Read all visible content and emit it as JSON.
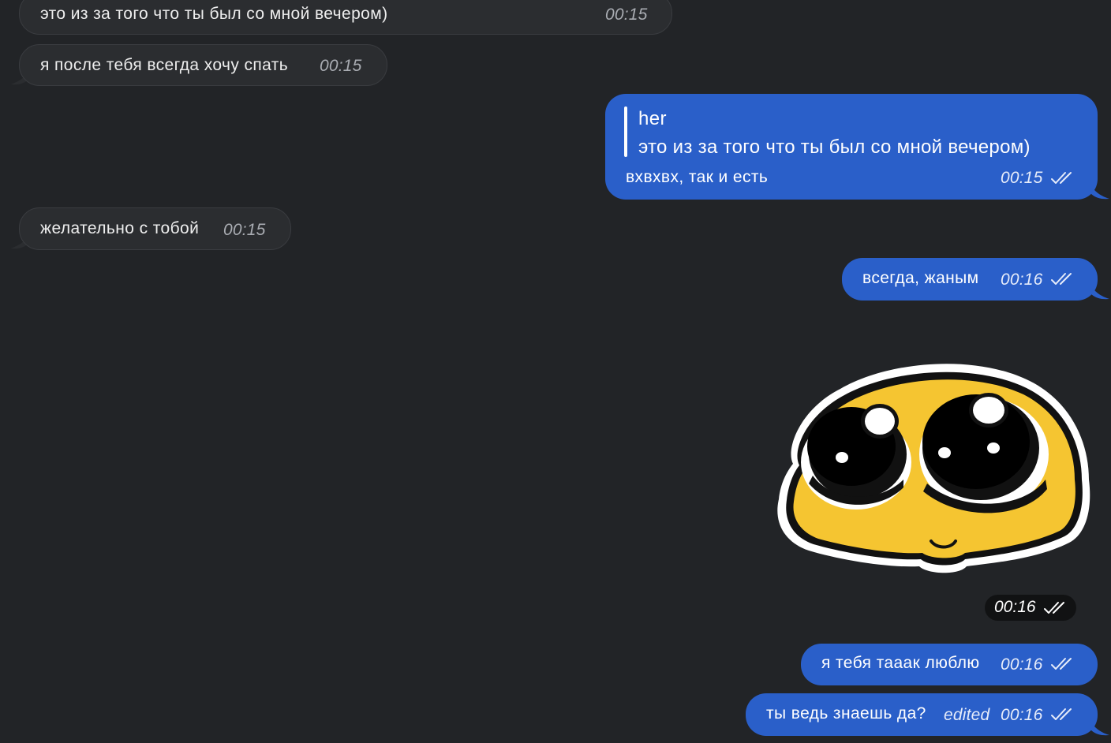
{
  "messages": {
    "m1": {
      "text": "это из за того что ты был со мной вечером)",
      "time": "00:15"
    },
    "m2": {
      "text": "я после тебя всегда хочу спать",
      "time": "00:15"
    },
    "m3": {
      "reply_author": "her",
      "reply_quote": "это из за того что ты был со мной вечером)",
      "text": "вхвхвх, так и есть",
      "time": "00:15"
    },
    "m4": {
      "text": "желательно с тобой",
      "time": "00:15"
    },
    "m5": {
      "text": "всегда, жаным",
      "time": "00:16"
    },
    "m6": {
      "sticker": "pleading-face-sticker",
      "time": "00:16"
    },
    "m7": {
      "text": "я тебя тааак люблю",
      "time": "00:16"
    },
    "m8": {
      "text": "ты ведь знаешь да?",
      "edited_label": "edited",
      "time": "00:16"
    }
  },
  "colors": {
    "background": "#222427",
    "incoming_bubble": "#2b2d30",
    "outgoing_bubble": "#2a5fc9"
  },
  "icons": {
    "read_status": "double-check-icon"
  }
}
